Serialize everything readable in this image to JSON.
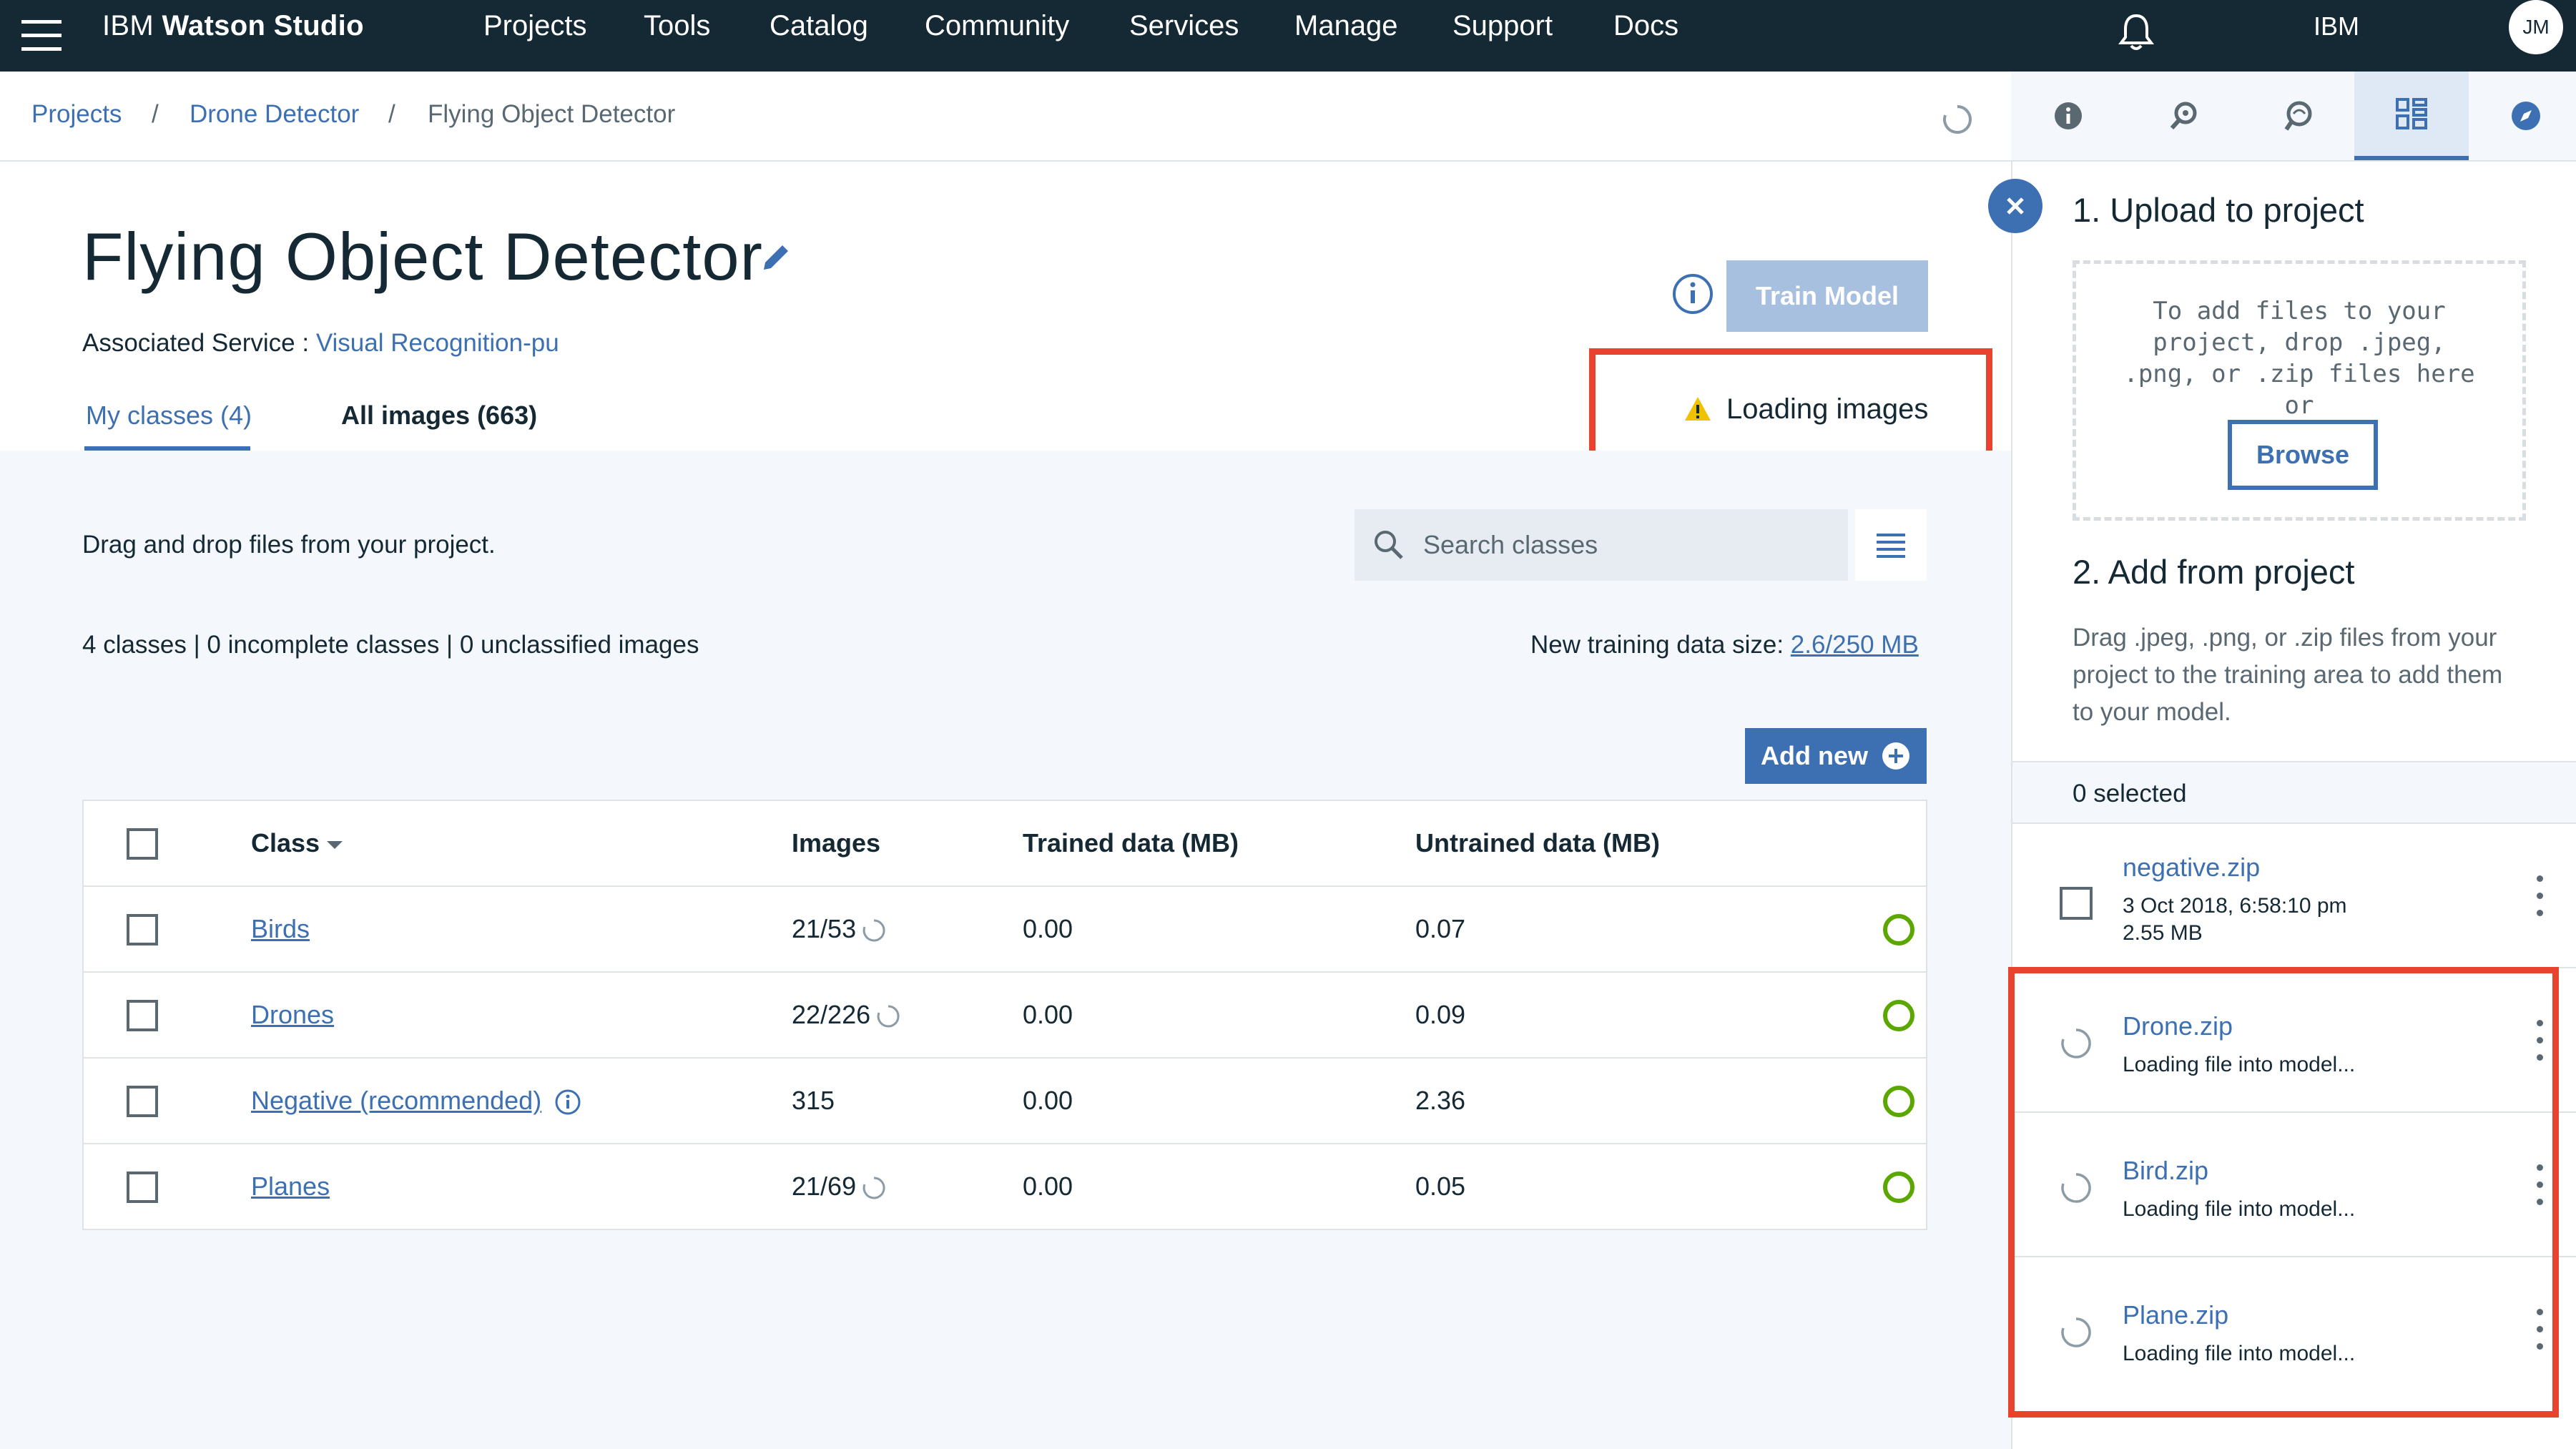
{
  "topnav": {
    "brand_prefix": "IBM",
    "brand_name": "Watson Studio",
    "items": [
      "Projects",
      "Tools",
      "Catalog",
      "Community",
      "Services",
      "Manage",
      "Support",
      "Docs"
    ],
    "account": "IBM",
    "avatar_initials": "JM"
  },
  "breadcrumb": {
    "items": [
      "Projects",
      "Drone Detector",
      "Flying Object Detector"
    ],
    "separator": "/"
  },
  "toolbar": {
    "icons": [
      "info-icon",
      "find-data-icon",
      "feedback-icon",
      "data-assets-icon",
      "explore-icon"
    ],
    "active": "data-assets-icon"
  },
  "header": {
    "title": "Flying Object Detector",
    "assoc_label": "Associated Service : ",
    "assoc_service": "Visual Recognition-pu",
    "train_button": "Train Model",
    "loading_status": "Loading images"
  },
  "tabs": {
    "my_classes": "My classes (4)",
    "all_images": "All images (663)"
  },
  "content": {
    "drag_text": "Drag and drop files from your project.",
    "search_placeholder": "Search classes",
    "summary": "4 classes | 0 incomplete classes | 0 unclassified images",
    "datasize_label": "New training data size: ",
    "datasize_value": "2.6/250 MB",
    "add_new": "Add new"
  },
  "table": {
    "headers": {
      "class": "Class",
      "images": "Images",
      "trained": "Trained data (MB)",
      "untrained": "Untrained data (MB)"
    },
    "rows": [
      {
        "class": "Birds",
        "images": "21/53",
        "trained": "0.00",
        "untrained": "0.07"
      },
      {
        "class": "Drones",
        "images": "22/226",
        "trained": "0.00",
        "untrained": "0.09"
      },
      {
        "class": "Negative (recommended)",
        "images": "315",
        "trained": "0.00",
        "untrained": "2.36"
      },
      {
        "class": "Planes",
        "images": "21/69",
        "trained": "0.00",
        "untrained": "0.05"
      }
    ]
  },
  "panel": {
    "upload_heading": "1. Upload to project",
    "dropzone_text": "To add files to your project, drop .jpeg, .png, or .zip files here or",
    "browse": "Browse",
    "add_heading": "2. Add from project",
    "add_desc": "Drag .jpeg, .png, or .zip files from your project to the training area to add them to your model.",
    "selected": "0 selected",
    "files": [
      {
        "name": "negative.zip",
        "date": "3 Oct 2018, 6:58:10 pm",
        "size": "2.55 MB"
      },
      {
        "name": "Drone.zip",
        "status": "Loading file into model..."
      },
      {
        "name": "Bird.zip",
        "status": "Loading file into model..."
      },
      {
        "name": "Plane.zip",
        "status": "Loading file into model..."
      }
    ]
  },
  "colors": {
    "nav_bg": "#152935",
    "accent": "#3d70b2",
    "highlight_box": "#e8432e",
    "status_ok": "#5aa700",
    "warning": "#efc100"
  }
}
